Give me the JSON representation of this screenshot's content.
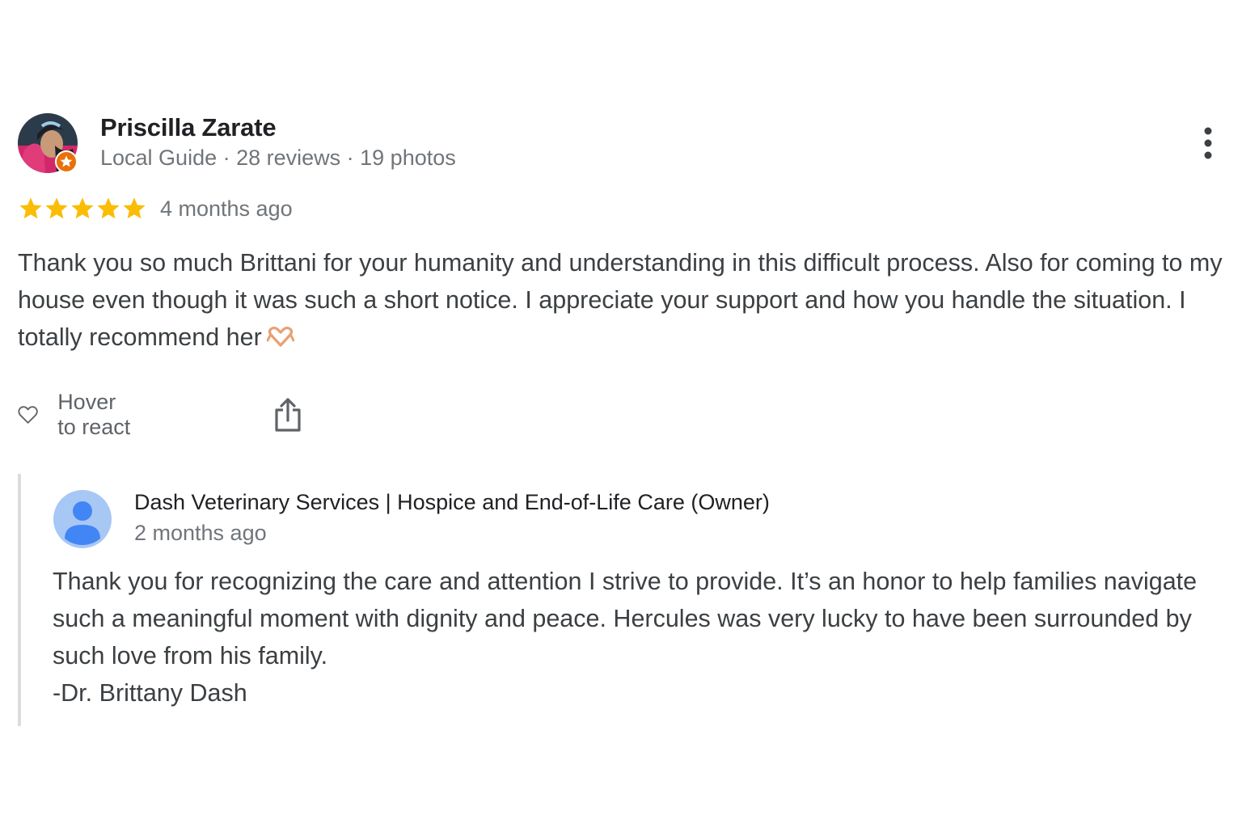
{
  "review": {
    "reviewer_name": "Priscilla Zarate",
    "reviewer_meta": "Local Guide · 28 reviews · 19 photos",
    "rating": 5,
    "date": "4 months ago",
    "text": "Thank you so much Brittani for your humanity and understanding in this difficult process. Also for coming to my house even though it was such a short notice. I appreciate your support and how you handle the situation. I totally recommend her",
    "emoji": "heart-hands-emoji"
  },
  "actions": {
    "react_label": "Hover to react"
  },
  "owner_reply": {
    "name": "Dash Veterinary Services | Hospice and End-of-Life Care (Owner)",
    "date": "2 months ago",
    "text_lines": [
      "Thank you for recognizing the care and attention I strive to provide. It’s an honor to help families navigate such a meaningful moment with dignity and peace. Hercules was very lucky to have been surrounded by such love from his family.",
      "-Dr. Brittany Dash"
    ]
  },
  "colors": {
    "star": "#fbbc04",
    "guide_badge": "#e8710a",
    "owner_avatar_bg": "#a7c7f5",
    "owner_avatar_fg": "#4285f4",
    "reply_rule": "#dadce0"
  },
  "icons": {
    "more": "more-vert-icon",
    "react": "heart-outline-icon",
    "share": "share-icon"
  }
}
